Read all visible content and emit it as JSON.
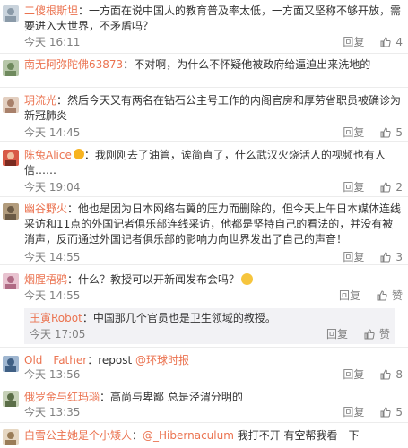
{
  "ui": {
    "reply_label": "回复",
    "like_icon": "thumbs-up-icon",
    "username_color": "#eb7350",
    "meta_color": "#808080"
  },
  "comments": [
    {
      "user": "二傻根斯坦",
      "sep": "：",
      "text": "一方面在说中国人的教育普及率太低，一方面又坚称不够开放，需要进入大世界，不矛盾吗？",
      "time": "今天 16:11",
      "likes": "4"
    },
    {
      "user": "南无阿弥陀佛63873",
      "sep": "：",
      "text": "不对啊，为什么不怀疑他被政府给逼迫出来洗地的",
      "time": "",
      "likes": ""
    },
    {
      "user": "玥流光",
      "sep": "：",
      "text": "然后今天又有两名在钻石公主号工作的内阁官房和厚劳省职员被确诊为新冠肺炎",
      "time": "今天 14:45",
      "likes": "5"
    },
    {
      "user": "陈兔Alice",
      "sep": "：",
      "text": "我刚刚去了油管，诶简直了，什么武汉火烧活人的视频也有人信……",
      "time": "今天 19:04",
      "likes": "2"
    },
    {
      "user": "幽谷野火",
      "sep": "：",
      "text": "他也是因为日本网络右翼的压力而删除的，但今天上午日本媒体连线采访和11点的外国记者俱乐部连线采访，他都是坚持自己的看法的，并没有被消声，反而通过外国记者俱乐部的影响力向世界发出了自己的声音！",
      "time": "今天 14:55",
      "likes": "3"
    },
    {
      "user": "烟腥梧鸦",
      "sep": "：",
      "text": "什么？教授可以开新闻发布会吗？",
      "time": "今天 14:55",
      "likes": "",
      "like_label": "赞"
    },
    {
      "user": "Old__Father",
      "sep": "：",
      "text": "repost ",
      "mention": "@环球时报",
      "time": "今天 13:56",
      "likes": "8"
    },
    {
      "user": "俄罗金与红玛瑙",
      "sep": "：",
      "text": "高尚与卑鄙 总是泾渭分明的",
      "time": "今天 13:35",
      "likes": "5"
    },
    {
      "user": "白雪公主她是个小矮人",
      "sep": "：",
      "mention": "@_Hibernaculum",
      "text": " 我打不开 有空帮我看一下",
      "time": "",
      "likes": ""
    }
  ],
  "subreply": {
    "user": "王寅Robot",
    "sep": "：",
    "text": "中国那几个官员也是卫生领域的教授。",
    "time": "今天 17:05",
    "like_label": "赞"
  }
}
